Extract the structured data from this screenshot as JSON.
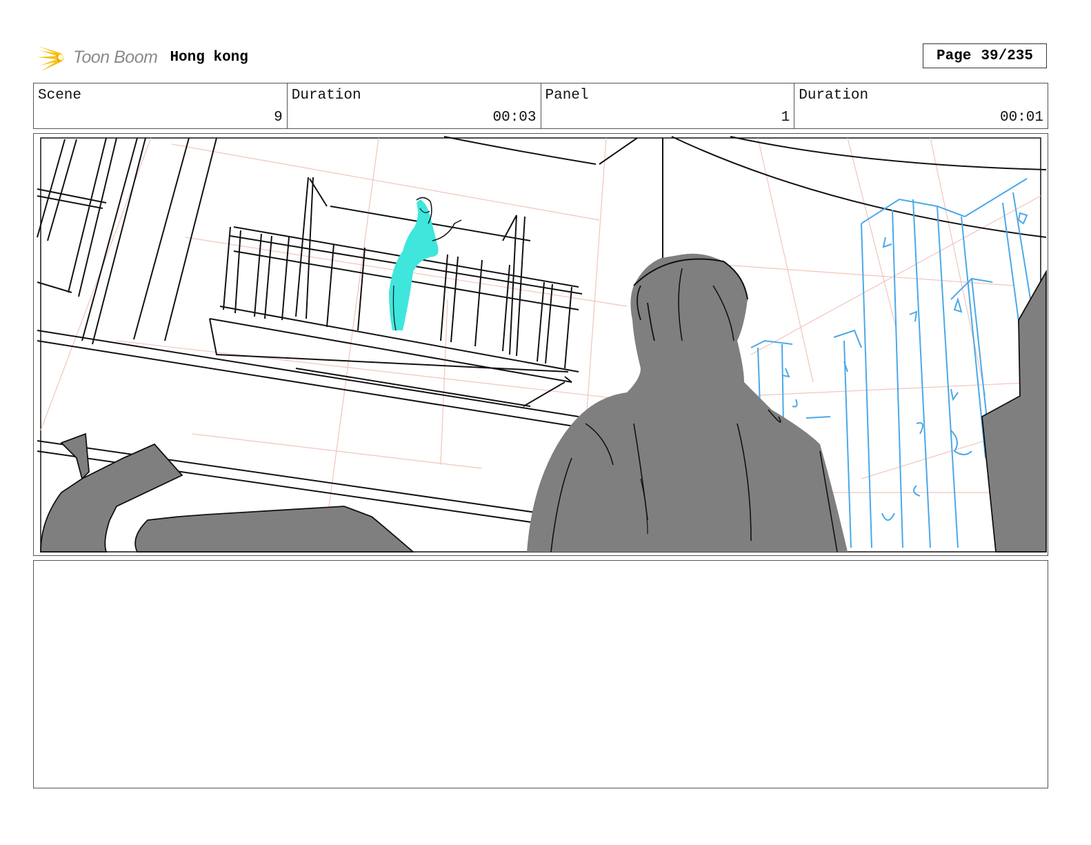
{
  "header": {
    "logo_text": "Toon Boom",
    "project_title": "Hong kong",
    "page_label": "Page",
    "page_number": "39/235"
  },
  "info_bar": {
    "scene_label": "Scene",
    "scene_value": "9",
    "scene_duration_label": "Duration",
    "scene_duration_value": "00:03",
    "panel_label": "Panel",
    "panel_value": "1",
    "panel_duration_label": "Duration",
    "panel_duration_value": "00:01"
  },
  "colors": {
    "sketch_line": "#111111",
    "fill_gray": "#7f7f7f",
    "highlight_cyan": "#3fe6dc",
    "building_blue": "#4aa8e8",
    "grid_pink": "#f2c4bc",
    "logo_yellow": "#f7c21a"
  },
  "notes": {
    "text": ""
  }
}
